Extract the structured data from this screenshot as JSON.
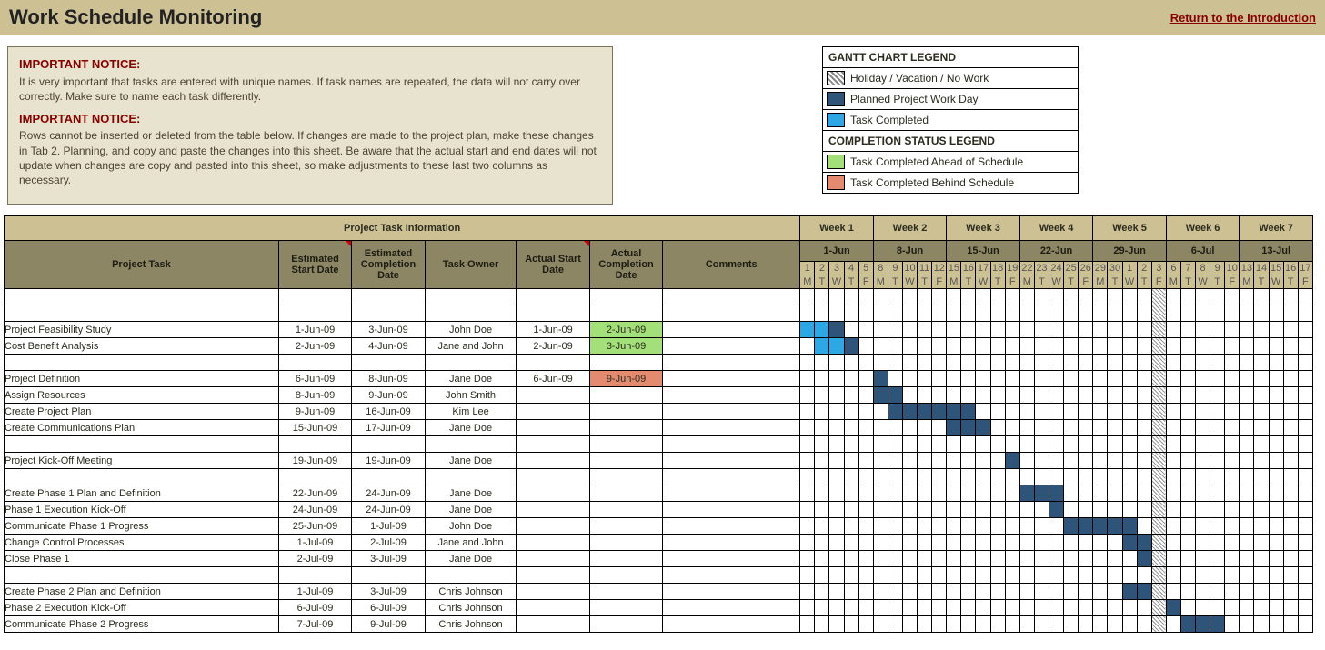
{
  "title": "Work Schedule Monitoring",
  "return_link": "Return to the Introduction",
  "notice": {
    "hdr": "IMPORTANT NOTICE:",
    "p1": "It is very important that tasks are entered with unique names. If task names are repeated, the data will not carry over correctly. Make sure to name each task differently.",
    "p2": "Rows cannot be inserted or deleted from the table below. If changes are made to the project plan, make these changes in Tab 2. Planning, and copy and paste the changes into this sheet. Be aware that the actual start and end dates will not update when changes are copy and pasted into this sheet, so make adjustments to these last two columns as necessary."
  },
  "legend": {
    "gantt_title": "GANTT CHART LEGEND",
    "holiday": "Holiday / Vacation / No Work",
    "planned": "Planned Project Work Day",
    "completed": "Task Completed",
    "status_title": "COMPLETION STATUS LEGEND",
    "ahead": "Task Completed Ahead of Schedule",
    "behind": "Task Completed Behind Schedule"
  },
  "table": {
    "info_header": "Project Task Information",
    "cols": {
      "task": "Project Task",
      "est_start": "Estimated Start Date",
      "est_end": "Estimated Completion Date",
      "owner": "Task Owner",
      "act_start": "Actual Start Date",
      "act_end": "Actual Completion Date",
      "comments": "Comments"
    }
  },
  "chart_data": {
    "type": "gantt",
    "start_date": "1-Jun-09",
    "weeks": [
      {
        "label": "Week 1",
        "start": "1-Jun",
        "days": [
          1,
          2,
          3,
          4,
          5
        ]
      },
      {
        "label": "Week 2",
        "start": "8-Jun",
        "days": [
          8,
          9,
          10,
          11,
          12
        ]
      },
      {
        "label": "Week 3",
        "start": "15-Jun",
        "days": [
          15,
          16,
          17,
          18,
          19
        ]
      },
      {
        "label": "Week 4",
        "start": "22-Jun",
        "days": [
          22,
          23,
          24,
          25,
          26
        ]
      },
      {
        "label": "Week 5",
        "start": "29-Jun",
        "days": [
          29,
          30,
          1,
          2,
          3
        ]
      },
      {
        "label": "Week 6",
        "start": "6-Jul",
        "days": [
          6,
          7,
          8,
          9,
          10
        ]
      },
      {
        "label": "Week 7",
        "start": "13-Jul",
        "days": [
          13,
          14,
          15,
          16,
          17
        ]
      }
    ],
    "dow": [
      "M",
      "T",
      "W",
      "T",
      "F"
    ],
    "holiday_day_index": 24,
    "rows": [
      {
        "task": "",
        "est_start": "",
        "est_end": "",
        "owner": "",
        "act_start": "",
        "act_end": "",
        "status": "",
        "bars": []
      },
      {
        "task": "",
        "est_start": "",
        "est_end": "",
        "owner": "",
        "act_start": "",
        "act_end": "",
        "status": "",
        "bars": []
      },
      {
        "task": "Project Feasibility Study",
        "est_start": "1-Jun-09",
        "est_end": "3-Jun-09",
        "owner": "John Doe",
        "act_start": "1-Jun-09",
        "act_end": "2-Jun-09",
        "status": "ahead",
        "bars": [
          {
            "from": 0,
            "to": 1,
            "type": "c"
          },
          {
            "from": 2,
            "to": 2,
            "type": "p"
          }
        ]
      },
      {
        "task": "Cost Benefit Analysis",
        "est_start": "2-Jun-09",
        "est_end": "4-Jun-09",
        "owner": "Jane and John",
        "act_start": "2-Jun-09",
        "act_end": "3-Jun-09",
        "status": "ahead",
        "bars": [
          {
            "from": 1,
            "to": 2,
            "type": "c"
          },
          {
            "from": 3,
            "to": 3,
            "type": "p"
          }
        ]
      },
      {
        "task": "",
        "est_start": "",
        "est_end": "",
        "owner": "",
        "act_start": "",
        "act_end": "",
        "status": "",
        "bars": []
      },
      {
        "task": "Project Definition",
        "est_start": "6-Jun-09",
        "est_end": "8-Jun-09",
        "owner": "Jane Doe",
        "act_start": "6-Jun-09",
        "act_end": "9-Jun-09",
        "status": "behind",
        "bars": [
          {
            "from": 5,
            "to": 5,
            "type": "p"
          }
        ]
      },
      {
        "task": "Assign Resources",
        "est_start": "8-Jun-09",
        "est_end": "9-Jun-09",
        "owner": "John Smith",
        "act_start": "",
        "act_end": "",
        "status": "",
        "bars": [
          {
            "from": 5,
            "to": 6,
            "type": "p"
          }
        ]
      },
      {
        "task": "Create Project Plan",
        "est_start": "9-Jun-09",
        "est_end": "16-Jun-09",
        "owner": "Kim Lee",
        "act_start": "",
        "act_end": "",
        "status": "",
        "bars": [
          {
            "from": 6,
            "to": 11,
            "type": "p"
          }
        ]
      },
      {
        "task": "Create Communications Plan",
        "est_start": "15-Jun-09",
        "est_end": "17-Jun-09",
        "owner": "Jane Doe",
        "act_start": "",
        "act_end": "",
        "status": "",
        "bars": [
          {
            "from": 10,
            "to": 12,
            "type": "p"
          }
        ]
      },
      {
        "task": "",
        "est_start": "",
        "est_end": "",
        "owner": "",
        "act_start": "",
        "act_end": "",
        "status": "",
        "bars": []
      },
      {
        "task": "Project Kick-Off Meeting",
        "est_start": "19-Jun-09",
        "est_end": "19-Jun-09",
        "owner": "Jane Doe",
        "act_start": "",
        "act_end": "",
        "status": "",
        "bars": [
          {
            "from": 14,
            "to": 14,
            "type": "p"
          }
        ]
      },
      {
        "task": "",
        "est_start": "",
        "est_end": "",
        "owner": "",
        "act_start": "",
        "act_end": "",
        "status": "",
        "bars": []
      },
      {
        "task": "Create Phase 1 Plan and Definition",
        "est_start": "22-Jun-09",
        "est_end": "24-Jun-09",
        "owner": "Jane Doe",
        "act_start": "",
        "act_end": "",
        "status": "",
        "bars": [
          {
            "from": 15,
            "to": 17,
            "type": "p"
          }
        ]
      },
      {
        "task": "Phase 1 Execution Kick-Off",
        "est_start": "24-Jun-09",
        "est_end": "24-Jun-09",
        "owner": "Jane Doe",
        "act_start": "",
        "act_end": "",
        "status": "",
        "bars": [
          {
            "from": 17,
            "to": 17,
            "type": "p"
          }
        ]
      },
      {
        "task": "Communicate Phase 1 Progress",
        "est_start": "25-Jun-09",
        "est_end": "1-Jul-09",
        "owner": "John Doe",
        "act_start": "",
        "act_end": "",
        "status": "",
        "bars": [
          {
            "from": 18,
            "to": 22,
            "type": "p"
          }
        ]
      },
      {
        "task": "Change Control Processes",
        "est_start": "1-Jul-09",
        "est_end": "2-Jul-09",
        "owner": "Jane and John",
        "act_start": "",
        "act_end": "",
        "status": "",
        "bars": [
          {
            "from": 22,
            "to": 23,
            "type": "p"
          }
        ]
      },
      {
        "task": "Close Phase 1",
        "est_start": "2-Jul-09",
        "est_end": "3-Jul-09",
        "owner": "Jane Doe",
        "act_start": "",
        "act_end": "",
        "status": "",
        "bars": [
          {
            "from": 23,
            "to": 23,
            "type": "p"
          }
        ]
      },
      {
        "task": "",
        "est_start": "",
        "est_end": "",
        "owner": "",
        "act_start": "",
        "act_end": "",
        "status": "",
        "bars": []
      },
      {
        "task": "Create Phase 2 Plan and Definition",
        "est_start": "1-Jul-09",
        "est_end": "3-Jul-09",
        "owner": "Chris Johnson",
        "act_start": "",
        "act_end": "",
        "status": "",
        "bars": [
          {
            "from": 22,
            "to": 23,
            "type": "p"
          }
        ]
      },
      {
        "task": "Phase 2 Execution Kick-Off",
        "est_start": "6-Jul-09",
        "est_end": "6-Jul-09",
        "owner": "Chris Johnson",
        "act_start": "",
        "act_end": "",
        "status": "",
        "bars": [
          {
            "from": 25,
            "to": 25,
            "type": "p"
          }
        ]
      },
      {
        "task": "Communicate Phase 2 Progress",
        "est_start": "7-Jul-09",
        "est_end": "9-Jul-09",
        "owner": "Chris Johnson",
        "act_start": "",
        "act_end": "",
        "status": "",
        "bars": [
          {
            "from": 26,
            "to": 28,
            "type": "p"
          }
        ]
      }
    ]
  }
}
